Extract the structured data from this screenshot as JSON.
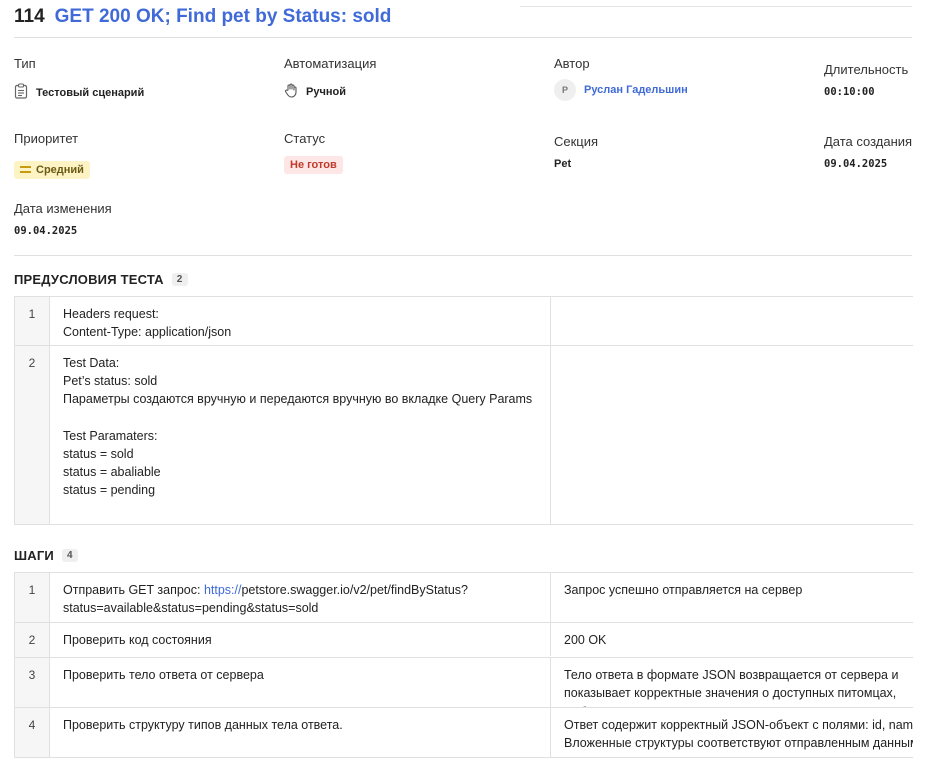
{
  "header": {
    "id": "114",
    "title": "GET 200 OK; Find pet by Status: sold"
  },
  "fields": {
    "type": {
      "label": "Тип",
      "value": "Тестовый сценарий",
      "icon": "clipboard-icon"
    },
    "automation": {
      "label": "Автоматизация",
      "value": "Ручной",
      "icon": "hand-icon"
    },
    "author": {
      "label": "Автор",
      "initial": "Р",
      "value": "Руслан Гадельшин"
    },
    "duration": {
      "label": "Длительность",
      "value": "00:10:00"
    },
    "priority": {
      "label": "Приоритет",
      "value": "Средний",
      "icon": "equals-icon"
    },
    "status": {
      "label": "Статус",
      "value": "Не готов"
    },
    "section": {
      "label": "Секция",
      "value": "Pet"
    },
    "created": {
      "label": "Дата создания",
      "value": "09.04.2025"
    },
    "modified": {
      "label": "Дата изменения",
      "value": "09.04.2025"
    }
  },
  "preconditions": {
    "title": "ПРЕДУСЛОВИЯ ТЕСТА",
    "count": "2",
    "rows": [
      {
        "n": "1",
        "text": "Headers request:\nContent-Type: application/json",
        "result": ""
      },
      {
        "n": "2",
        "text": "Test Data:\nPet’s status: sold\nПараметры создаются вручную и передаются вручную во вкладке Query Params\n\nTest Paramaters:\nstatus = sold\nstatus = abaliable\nstatus = pending",
        "result": ""
      }
    ]
  },
  "steps": {
    "title": "ШАГИ",
    "count": "4",
    "step1": {
      "n": "1",
      "prefix": "Отправить GET запрос: ",
      "link": "https://",
      "rest": "petstore.swagger.io/v2/pet/findByStatus?status=available&status=pending&status=sold",
      "result": "Запрос успешно отправляется на сервер"
    },
    "rows": [
      {
        "n": "2",
        "text": "Проверить код состояния",
        "result": "200 OK"
      },
      {
        "n": "3",
        "text": "Проверить тело ответа от сервера",
        "result": "Тело ответа в формате JSON возвращается от сервера и показывает корректные значения о доступных питомцах, выбранных по статусу"
      },
      {
        "n": "4",
        "text": "Проверить структуру типов данных тела ответа.",
        "result_line1": "Ответ содержит корректный JSON-объект с полями: id, name, status",
        "result_line2": "Вложенные структуры соответствуют отправленным данным."
      }
    ]
  }
}
